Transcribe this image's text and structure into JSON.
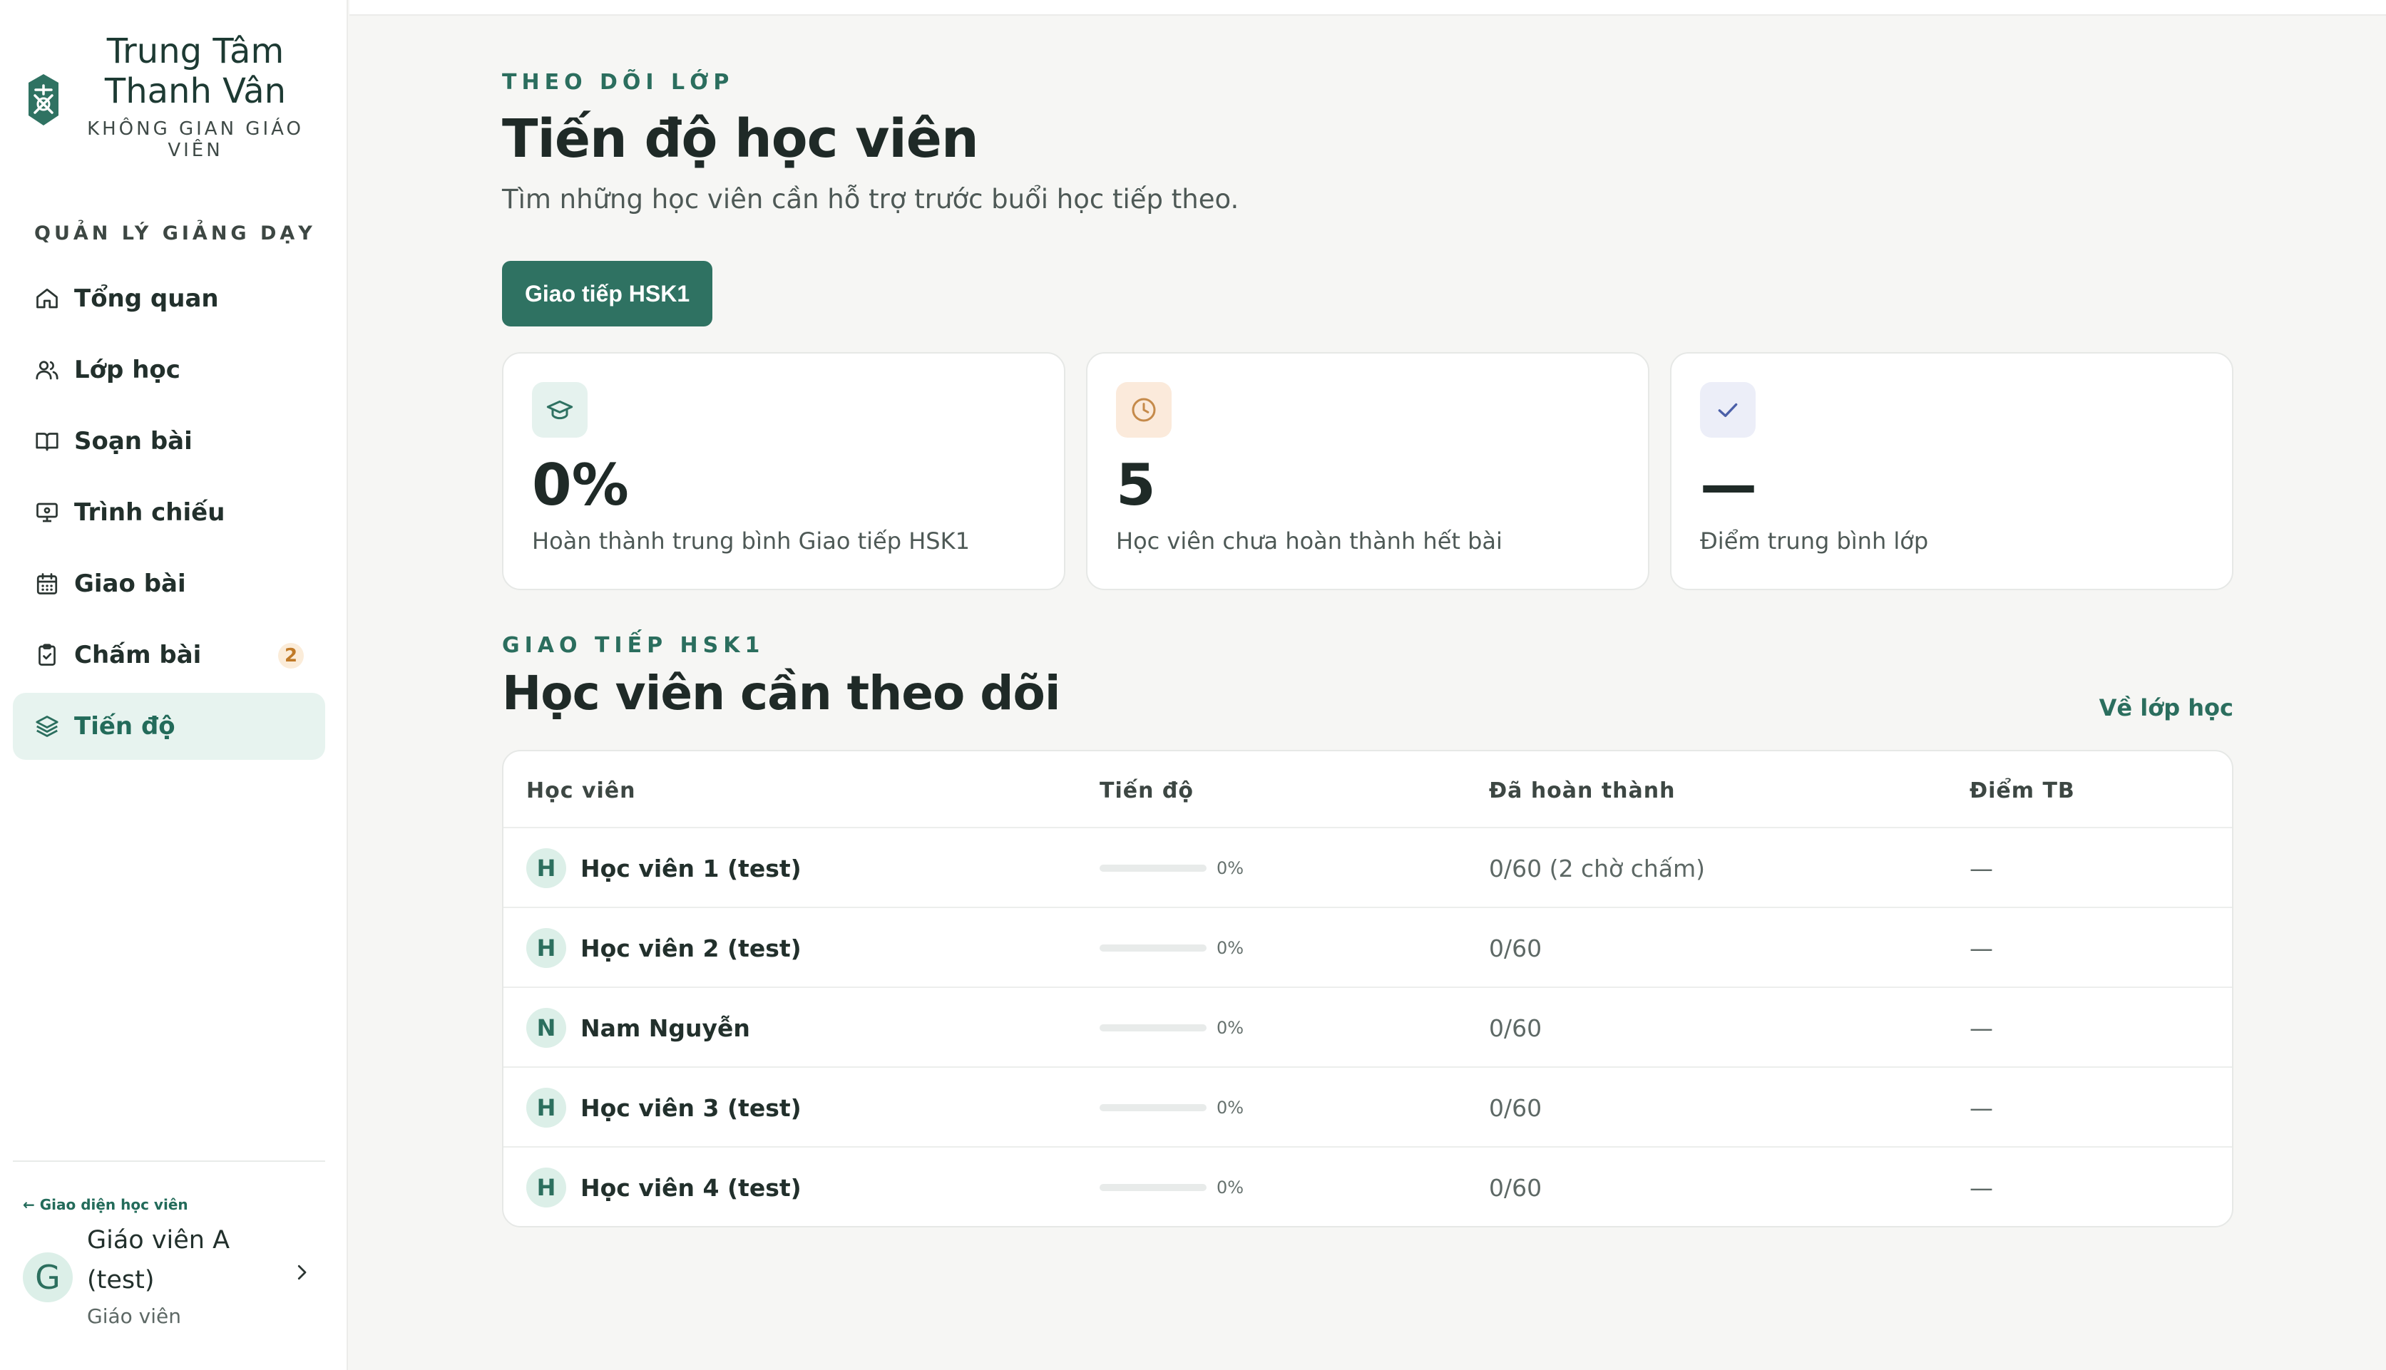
{
  "brand": {
    "name": "Trung Tâm Thanh Vân",
    "subtitle": "KHÔNG GIAN GIÁO VIÊN",
    "logo_icon": "lantern-logo-icon"
  },
  "nav": {
    "section": "QUẢN LÝ GIẢNG DẠY",
    "items": [
      {
        "label": "Tổng quan",
        "icon": "home-icon"
      },
      {
        "label": "Lớp học",
        "icon": "users-icon"
      },
      {
        "label": "Soạn bài",
        "icon": "book-icon"
      },
      {
        "label": "Trình chiếu",
        "icon": "presentation-icon"
      },
      {
        "label": "Giao bài",
        "icon": "calendar-icon"
      },
      {
        "label": "Chấm bài",
        "icon": "clipboard-check-icon",
        "badge": "2"
      },
      {
        "label": "Tiến độ",
        "icon": "layers-icon",
        "active": true
      }
    ]
  },
  "user": {
    "switch_link": "← Giao diện học viên",
    "avatar_letter": "G",
    "name": "Giáo viên A (test)",
    "role": "Giáo viên"
  },
  "header": {
    "eyebrow": "THEO DÕI LỚP",
    "title": "Tiến độ học viên",
    "subtitle": "Tìm những học viên cần hỗ trợ trước buổi học tiếp theo.",
    "class_button": "Giao tiếp HSK1"
  },
  "stats": [
    {
      "value": "0%",
      "label": "Hoàn thành trung bình Giao tiếp HSK1",
      "icon": "graduation-cap-icon",
      "icon_bg": "#e5f2ee",
      "icon_color": "#2f7262"
    },
    {
      "value": "5",
      "label": "Học viên chưa hoàn thành hết bài",
      "icon": "clock-icon",
      "icon_bg": "#fbeadb",
      "icon_color": "#c58a4a"
    },
    {
      "value": "—",
      "label": "Điểm trung bình lớp",
      "icon": "check-icon",
      "icon_bg": "#eceef8",
      "icon_color": "#4b5fa8"
    }
  ],
  "section": {
    "eyebrow": "GIAO TIẾP HSK1",
    "title": "Học viên cần theo dõi",
    "link": "Về lớp học"
  },
  "table": {
    "columns": [
      "Học viên",
      "Tiến độ",
      "Đã hoàn thành",
      "Điểm TB"
    ],
    "rows": [
      {
        "initial": "H",
        "name": "Học viên 1 (test)",
        "progress": 0,
        "progress_label": "0%",
        "completed": "0/60 (2 chờ chấm)",
        "avg": "—"
      },
      {
        "initial": "H",
        "name": "Học viên 2 (test)",
        "progress": 0,
        "progress_label": "0%",
        "completed": "0/60",
        "avg": "—"
      },
      {
        "initial": "N",
        "name": "Nam Nguyễn",
        "progress": 0,
        "progress_label": "0%",
        "completed": "0/60",
        "avg": "—"
      },
      {
        "initial": "H",
        "name": "Học viên 3 (test)",
        "progress": 0,
        "progress_label": "0%",
        "completed": "0/60",
        "avg": "—"
      },
      {
        "initial": "H",
        "name": "Học viên 4 (test)",
        "progress": 0,
        "progress_label": "0%",
        "completed": "0/60",
        "avg": "—"
      }
    ]
  },
  "colors": {
    "accent": "#2f7262",
    "accent_light": "#e7f3ef",
    "badge_bg": "#fbecd9",
    "badge_text": "#c07a28"
  }
}
